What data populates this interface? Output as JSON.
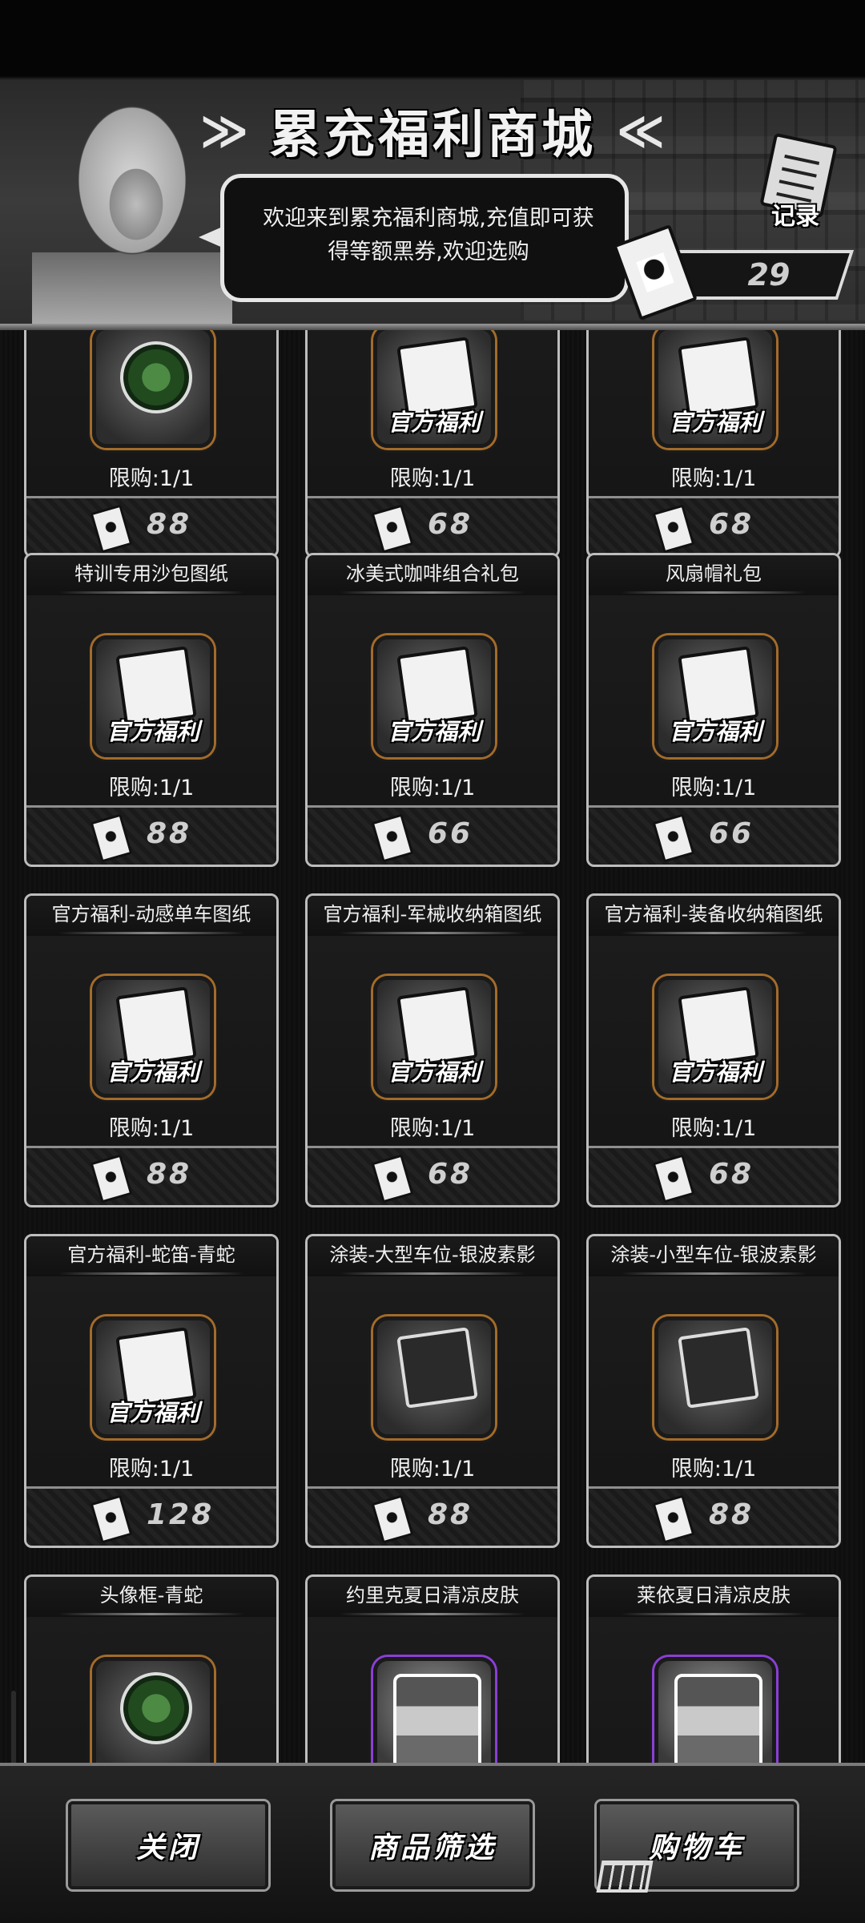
{
  "header": {
    "title": "累充福利商城",
    "welcome_text": "欢迎来到累充福利商城,充值即可获得等额黑券,欢迎选购",
    "record_label": "记录",
    "coupon_count": "29"
  },
  "items": [
    {
      "name": "",
      "badge": "",
      "limit": "限购:1/1",
      "price": "88"
    },
    {
      "name": "",
      "badge": "官方福利",
      "limit": "限购:1/1",
      "price": "68"
    },
    {
      "name": "",
      "badge": "官方福利",
      "limit": "限购:1/1",
      "price": "68"
    },
    {
      "name": "特训专用沙包图纸",
      "badge": "官方福利",
      "limit": "限购:1/1",
      "price": "88"
    },
    {
      "name": "冰美式咖啡组合礼包",
      "badge": "官方福利",
      "limit": "限购:1/1",
      "price": "66"
    },
    {
      "name": "风扇帽礼包",
      "badge": "官方福利",
      "limit": "限购:1/1",
      "price": "66"
    },
    {
      "name": "官方福利-动感单车图纸",
      "badge": "官方福利",
      "limit": "限购:1/1",
      "price": "88"
    },
    {
      "name": "官方福利-军械收纳箱图纸",
      "badge": "官方福利",
      "limit": "限购:1/1",
      "price": "68"
    },
    {
      "name": "官方福利-装备收纳箱图纸",
      "badge": "官方福利",
      "limit": "限购:1/1",
      "price": "68"
    },
    {
      "name": "官方福利-蛇笛-青蛇",
      "badge": "官方福利",
      "limit": "限购:1/1",
      "price": "128"
    },
    {
      "name": "涂装-大型车位-银波素影",
      "badge": "",
      "limit": "限购:1/1",
      "price": "88"
    },
    {
      "name": "涂装-小型车位-银波素影",
      "badge": "",
      "limit": "限购:1/1",
      "price": "88"
    },
    {
      "name": "头像框-青蛇",
      "badge": "",
      "limit": "",
      "price": ""
    },
    {
      "name": "约里克夏日清凉皮肤",
      "badge": "",
      "limit": "",
      "price": ""
    },
    {
      "name": "莱依夏日清凉皮肤",
      "badge": "",
      "limit": "",
      "price": ""
    }
  ],
  "footer": {
    "close_label": "关闭",
    "filter_label": "商品筛选",
    "cart_label": "购物车"
  },
  "colors": {
    "frame_orange": "#a36b2a",
    "frame_purple": "#8b3fd6"
  }
}
